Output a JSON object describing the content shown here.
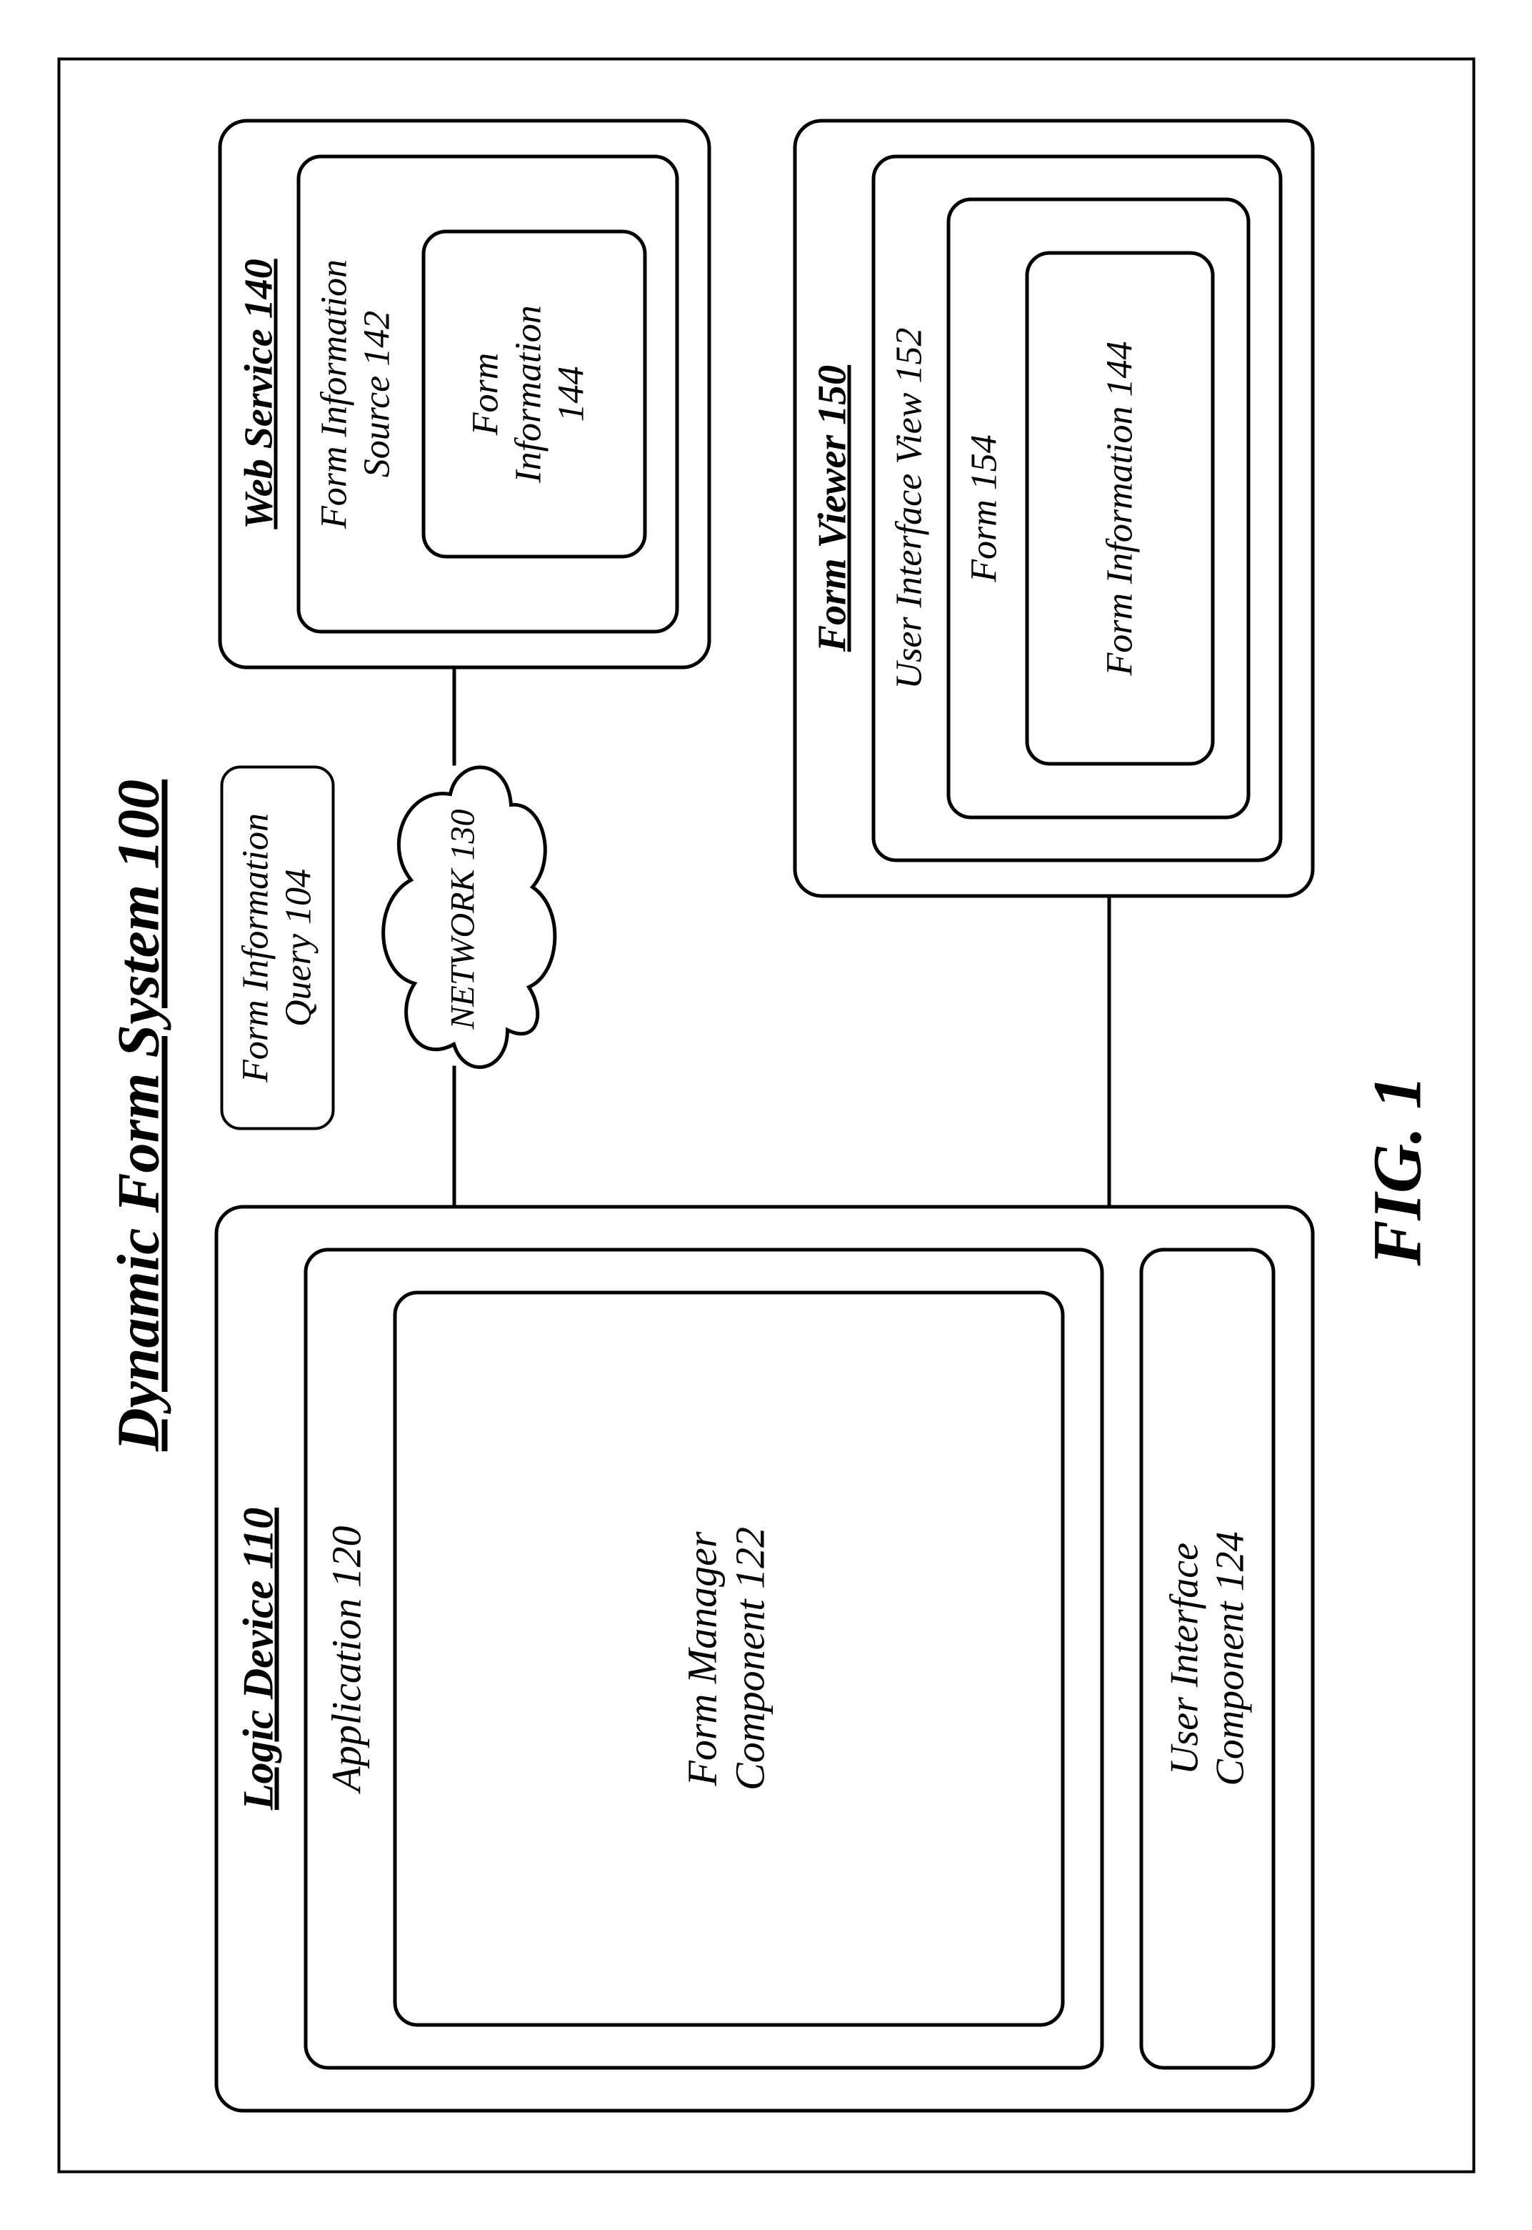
{
  "figure_label": "FIG. 1",
  "system_title": "Dynamic Form System 100",
  "logic_device": {
    "title": "Logic Device 110",
    "application": {
      "title": "Application 120",
      "form_manager": "Form Manager\nComponent 122"
    },
    "ui_component": "User Interface\nComponent 124"
  },
  "network": {
    "label": "NETWORK 130"
  },
  "query": {
    "label": "Form Information\nQuery 104"
  },
  "web_service": {
    "title": "Web Service 140",
    "source": {
      "title": "Form Information\nSource 142",
      "info": "Form\nInformation\n144"
    }
  },
  "form_viewer": {
    "title": "Form Viewer 150",
    "ui_view": {
      "title": "User Interface View 152",
      "form": {
        "title": "Form 154",
        "info": "Form Information 144"
      }
    }
  }
}
